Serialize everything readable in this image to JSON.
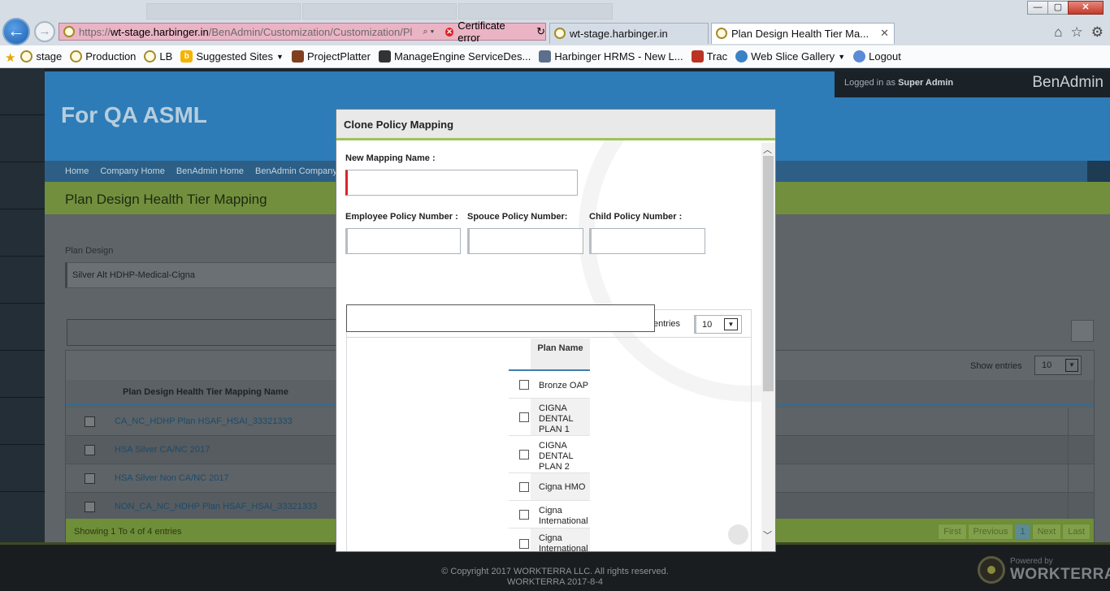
{
  "browser": {
    "url_prefix": "https://",
    "url_host": "wt-stage.harbinger.in",
    "url_path": "/BenAdmin/Customization/Customization/PlanD",
    "cert_error": "Certificate error",
    "tabs": [
      {
        "label": "wt-stage.harbinger.in"
      },
      {
        "label": "Plan Design Health Tier Ma..."
      }
    ],
    "window_controls": {
      "minimize": "—",
      "maximize": "▢",
      "close": "✕"
    }
  },
  "favorites": [
    {
      "label": "stage",
      "icon": "site-icon"
    },
    {
      "label": "Production",
      "icon": "site-icon"
    },
    {
      "label": "LB",
      "icon": "site-icon"
    },
    {
      "label": "Suggested Sites",
      "icon": "bing-icon",
      "dropdown": true
    },
    {
      "label": "ProjectPlatter",
      "icon": "project-icon"
    },
    {
      "label": "ManageEngine ServiceDes...",
      "icon": "manageengine-icon"
    },
    {
      "label": "Harbinger HRMS - New L...",
      "icon": "hrms-icon"
    },
    {
      "label": "Trac",
      "icon": "trac-icon"
    },
    {
      "label": "Web Slice Gallery",
      "icon": "ie-icon",
      "dropdown": true
    },
    {
      "label": "Logout",
      "icon": "ie-icon"
    }
  ],
  "app": {
    "header_title": "For QA ASML",
    "logged_in_prefix": "Logged in as",
    "logged_in_user": "Super Admin",
    "brand": "BenAdmin",
    "nav": [
      "Home",
      "Company Home",
      "BenAdmin Home",
      "BenAdmin Company"
    ],
    "page_title": "Plan Design Health Tier Mapping",
    "plan_design_label": "Plan Design",
    "plan_design_value": "Silver Alt HDHP-Medical-Cigna",
    "show_entries_label": "Show entries",
    "page_length": "10",
    "column_header": "Plan Design Health Tier Mapping Name",
    "rows": [
      "CA_NC_HDHP Plan HSAF_HSAI_33321333",
      "HSA Silver CA/NC 2017",
      "HSA Silver Non CA/NC 2017",
      "NON_CA_NC_HDHP Plan HSAF_HSAI_33321333"
    ],
    "info": "Showing 1 To 4 of 4 entries",
    "pager": [
      "First",
      "Previous",
      "1",
      "Next",
      "Last"
    ]
  },
  "modal": {
    "title": "Clone Policy Mapping",
    "new_mapping_label": "New Mapping Name :",
    "new_mapping_value": "",
    "employee_label": "Employee Policy Number :",
    "spouse_label": "Spouce Policy Number:",
    "child_label": "Child Policy Number :",
    "entries_label": "entries",
    "page_length": "10",
    "plan_column": "Plan Name",
    "plans": [
      "Bronze OAP",
      "CIGNA DENTAL PLAN 1",
      "CIGNA DENTAL PLAN 2",
      "Cigna HMO",
      "Cigna International",
      "Cigna International"
    ]
  },
  "footer": {
    "copyright": "© Copyright 2017 WORKTERRA LLC. All rights reserved.",
    "version": "WORKTERRA 2017-8-4",
    "powered_by": "Powered by",
    "powered_brand": "WORKTERRA"
  }
}
